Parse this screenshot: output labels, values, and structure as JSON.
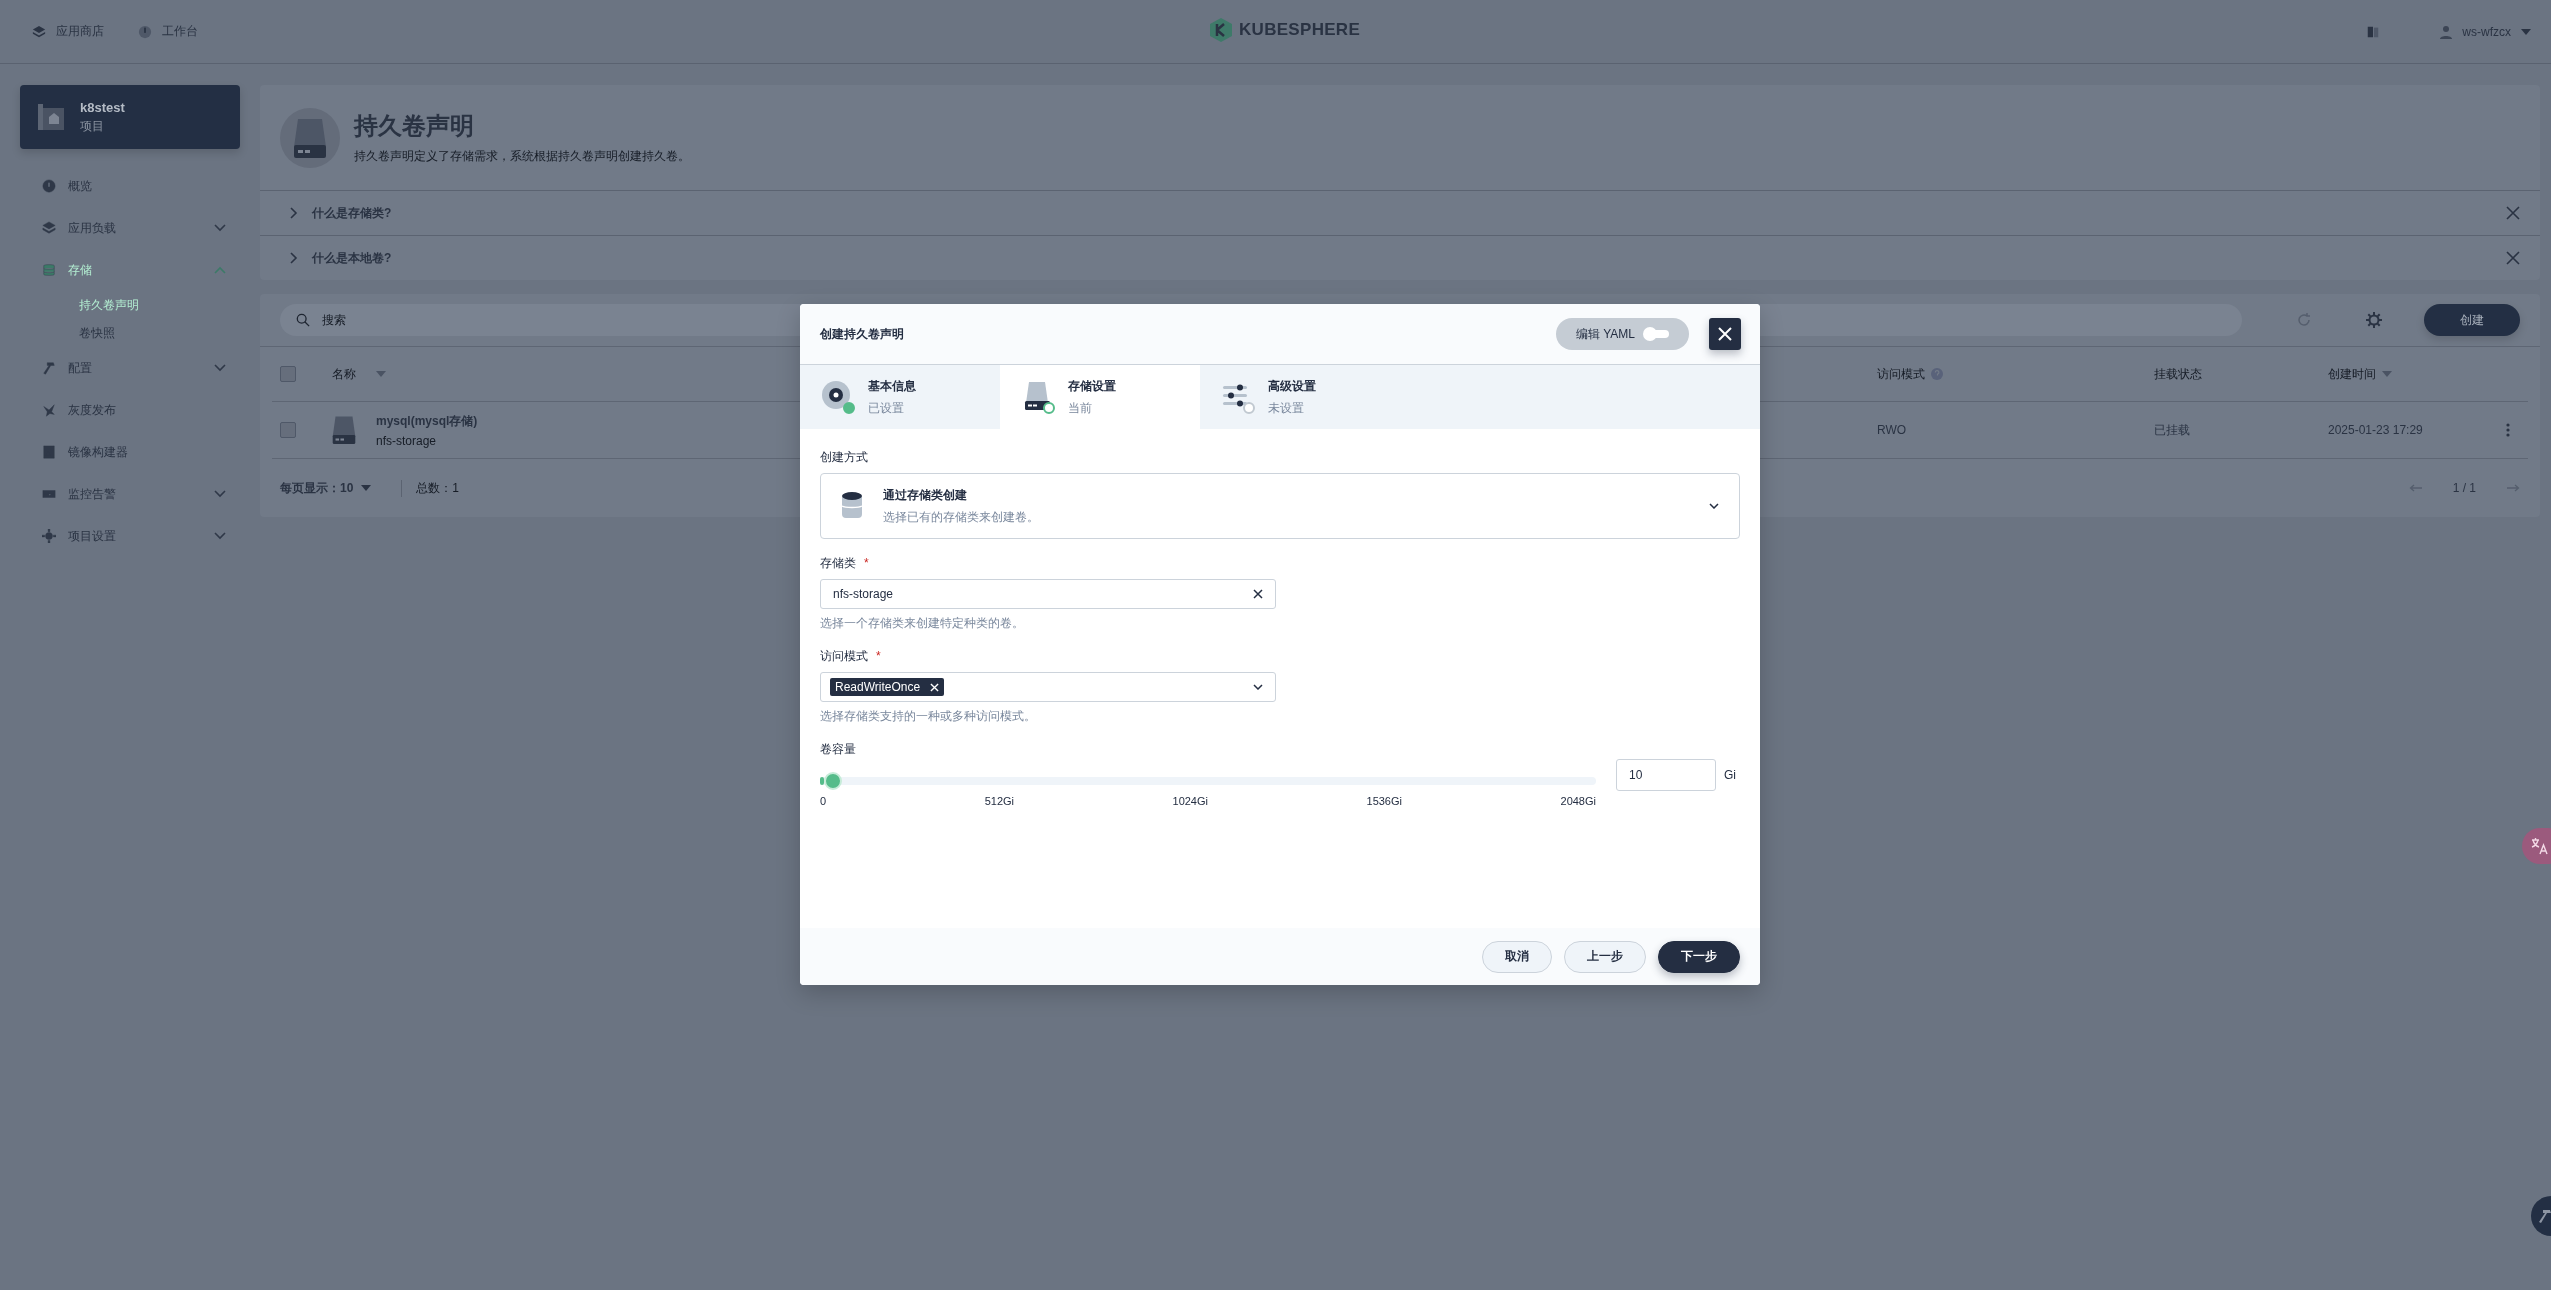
{
  "top_bar": {
    "nav": [
      {
        "label": "应用商店"
      },
      {
        "label": "工作台"
      }
    ],
    "logo": "KUBESPHERE",
    "user": "ws-wfzcx"
  },
  "sidebar": {
    "project": {
      "name": "k8stest",
      "type": "项目"
    },
    "items": [
      {
        "label": "概览",
        "expandable": false,
        "selected": false
      },
      {
        "label": "应用负载",
        "expandable": true,
        "expanded": false,
        "selected": false
      },
      {
        "label": "存储",
        "expandable": true,
        "expanded": true,
        "selected": true,
        "children": [
          {
            "label": "持久卷声明",
            "selected": true
          },
          {
            "label": "卷快照",
            "selected": false
          }
        ]
      },
      {
        "label": "配置",
        "expandable": true,
        "expanded": false,
        "selected": false
      },
      {
        "label": "灰度发布",
        "expandable": false,
        "selected": false
      },
      {
        "label": "镜像构建器",
        "expandable": false,
        "selected": false
      },
      {
        "label": "监控告警",
        "expandable": true,
        "expanded": false,
        "selected": false
      },
      {
        "label": "项目设置",
        "expandable": true,
        "expanded": false,
        "selected": false
      }
    ]
  },
  "page": {
    "title": "持久卷声明",
    "description": "持久卷声明定义了存储需求，系统根据持久卷声明创建持久卷。",
    "faqs": [
      {
        "question": "什么是存储类?"
      },
      {
        "question": "什么是本地卷?"
      }
    ],
    "search": {
      "placeholder": "搜索"
    },
    "create_button": "创建",
    "table": {
      "select_all_checked": false,
      "columns": [
        {
          "label": "名称",
          "sortable": true,
          "help": false
        },
        {
          "label": "访问模式",
          "sortable": false,
          "help": true
        },
        {
          "label": "挂载状态",
          "sortable": false,
          "help": false
        },
        {
          "label": "创建时间",
          "sortable": true,
          "help": false
        }
      ],
      "rows": [
        {
          "checked": false,
          "name": "mysql(mysql存储)",
          "subtitle": "nfs-storage",
          "access_mode": "RWO",
          "mount_status": "已挂载",
          "created": "2025-01-23 17:29"
        }
      ]
    },
    "footer": {
      "page_size_label": "每页显示：",
      "page_size": "10",
      "total": "总数：1",
      "pagination": "1 / 1"
    }
  },
  "dialog": {
    "title": "创建持久卷声明",
    "yaml_toggle": {
      "label": "编辑 YAML",
      "on": false
    },
    "steps": [
      {
        "title": "基本信息",
        "status": "已设置",
        "completed": true,
        "selected": false
      },
      {
        "title": "存储设置",
        "status": "当前",
        "completed": false,
        "selected": true
      },
      {
        "title": "高级设置",
        "status": "未设置",
        "completed": false,
        "selected": false
      }
    ],
    "method": {
      "label": "创建方式",
      "title": "通过存储类创建",
      "description": "选择已有的存储类来创建卷。"
    },
    "storage_class": {
      "label": "存储类",
      "required_mark": "*",
      "value": "nfs-storage",
      "hint": "选择一个存储类来创建特定种类的卷。"
    },
    "access_mode": {
      "label": "访问模式",
      "required_mark": "*",
      "tags": [
        "ReadWriteOnce"
      ],
      "hint": "选择存储类支持的一种或多种访问模式。"
    },
    "capacity": {
      "label": "卷容量",
      "level": 0.005,
      "ticks": [
        "0",
        "512Gi",
        "1024Gi",
        "1536Gi",
        "2048Gi"
      ],
      "value": "10",
      "unit": "Gi"
    },
    "buttons": [
      {
        "label": "取消",
        "kind": "secondary"
      },
      {
        "label": "上一步",
        "kind": "secondary"
      },
      {
        "label": "下一步",
        "kind": "primary"
      }
    ]
  }
}
